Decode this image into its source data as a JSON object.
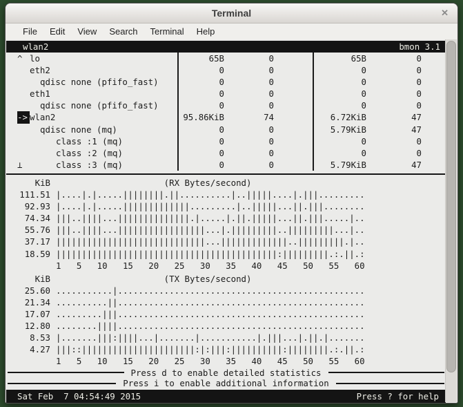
{
  "window": {
    "title": "Terminal",
    "close_glyph": "✕"
  },
  "menu": {
    "items": [
      "File",
      "Edit",
      "View",
      "Search",
      "Terminal",
      "Help"
    ]
  },
  "bmon": {
    "titlebar": {
      "left": "wlan2",
      "right": "bmon 3.1"
    },
    "table": {
      "rows": [
        {
          "indicator": "^",
          "name": "lo",
          "indent": 0,
          "selected": false,
          "rx_rate": "65B",
          "rx_pkts": "0",
          "tx_rate": "65B",
          "tx_pkts": "0"
        },
        {
          "indicator": "",
          "name": "eth2",
          "indent": 0,
          "selected": false,
          "rx_rate": "0",
          "rx_pkts": "0",
          "tx_rate": "0",
          "tx_pkts": "0"
        },
        {
          "indicator": "",
          "name": "qdisc none (pfifo_fast)",
          "indent": 1,
          "selected": false,
          "rx_rate": "0",
          "rx_pkts": "0",
          "tx_rate": "0",
          "tx_pkts": "0"
        },
        {
          "indicator": "",
          "name": "eth1",
          "indent": 0,
          "selected": false,
          "rx_rate": "0",
          "rx_pkts": "0",
          "tx_rate": "0",
          "tx_pkts": "0"
        },
        {
          "indicator": "",
          "name": "qdisc none (pfifo_fast)",
          "indent": 1,
          "selected": false,
          "rx_rate": "0",
          "rx_pkts": "0",
          "tx_rate": "0",
          "tx_pkts": "0"
        },
        {
          "indicator": "->",
          "name": "wlan2",
          "indent": 0,
          "selected": true,
          "rx_rate": "95.86KiB",
          "rx_pkts": "74",
          "tx_rate": "6.72KiB",
          "tx_pkts": "47"
        },
        {
          "indicator": "",
          "name": "qdisc none (mq)",
          "indent": 1,
          "selected": false,
          "rx_rate": "0",
          "rx_pkts": "0",
          "tx_rate": "5.79KiB",
          "tx_pkts": "47"
        },
        {
          "indicator": "",
          "name": "class :1 (mq)",
          "indent": 2,
          "selected": false,
          "rx_rate": "0",
          "rx_pkts": "0",
          "tx_rate": "0",
          "tx_pkts": "0"
        },
        {
          "indicator": "",
          "name": "class :2 (mq)",
          "indent": 2,
          "selected": false,
          "rx_rate": "0",
          "rx_pkts": "0",
          "tx_rate": "0",
          "tx_pkts": "0"
        },
        {
          "indicator": "⊥",
          "name": "class :3 (mq)",
          "indent": 2,
          "selected": false,
          "rx_rate": "0",
          "rx_pkts": "0",
          "tx_rate": "5.79KiB",
          "tx_pkts": "47"
        }
      ]
    },
    "rx_graph": {
      "unit": "KiB",
      "title": "(RX Bytes/second)",
      "axis": "1   5   10   15   20   25   30   35   40   45   50   55   60",
      "rows": [
        {
          "label": "111.51",
          "bars": "|....|.|.....||||||||.||..........|..|||||....|.|||........."
        },
        {
          "label": "92.93",
          "bars": "|....|.|.....|||||||||||||.........|..|||||...||.|||........"
        },
        {
          "label": "74.34",
          "bars": "|||..||||...||||||||||||||.|.....|.||.|||||...||.|||.....|.."
        },
        {
          "label": "55.76",
          "bars": "|||..||||...|||||||||||||||||...|.|||||||||..|||||||||...|.."
        },
        {
          "label": "37.17",
          "bars": "|||||||||||||||||||||||||||||...|||||||||||||..|||||||||.|.."
        },
        {
          "label": "18.59",
          "bars": "|||||||||||||||||||||||||||||||||||||||||||:|||||||||.:.||.:"
        }
      ]
    },
    "tx_graph": {
      "unit": "KiB",
      "title": "(TX Bytes/second)",
      "axis": "1   5   10   15   20   25   30   35   40   45   50   55   60",
      "rows": [
        {
          "label": "25.60",
          "bars": "...........|................................................"
        },
        {
          "label": "21.34",
          "bars": "..........||................................................"
        },
        {
          "label": "17.07",
          "bars": ".........|||................................................"
        },
        {
          "label": "12.80",
          "bars": "........||||................................................"
        },
        {
          "label": "8.53",
          "bars": "|.......|||:||||...|.......|...........|.|||...|.||.|......."
        },
        {
          "label": "4.27",
          "bars": "|||::||||||||||||||||||||||:|:|||:||||||||||:||||||||.:.||.:"
        }
      ]
    },
    "notices": [
      "Press d to enable detailed statistics",
      "Press i to enable additional information"
    ],
    "statusbar": {
      "left": "Sat Feb  7 04:54:49 2015",
      "right": "Press ? for help"
    }
  },
  "colors": {
    "desktop_bg": "#2e4d2e",
    "chrome_bg": "#f0efec",
    "terminal_bg": "#ebebe9",
    "inverse_bar_bg": "#141414",
    "inverse_bar_fg": "#eeeee6",
    "text": "#1c1c1c"
  }
}
